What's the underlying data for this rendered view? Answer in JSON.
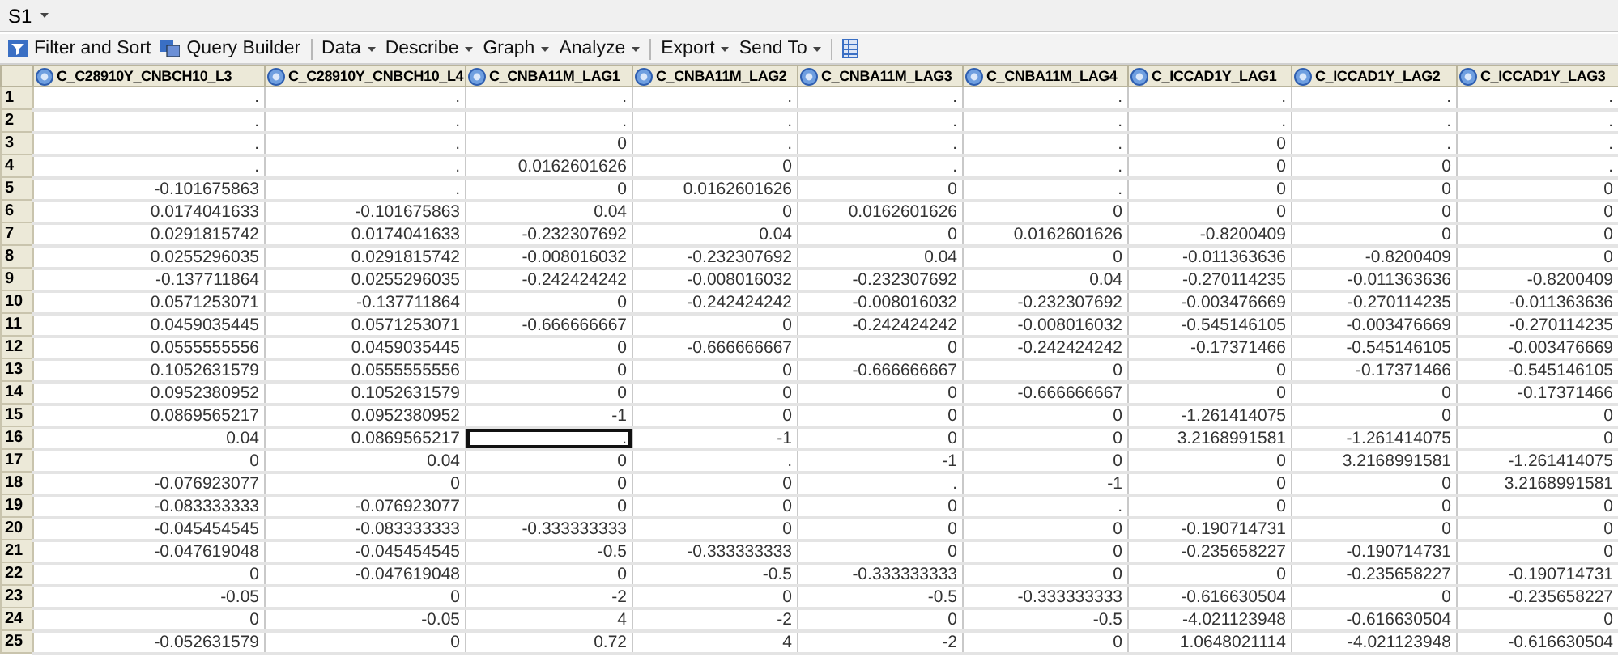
{
  "tab": {
    "label": "S1"
  },
  "toolbar": [
    {
      "kind": "tool",
      "label": "Filter and Sort"
    },
    {
      "kind": "tool",
      "label": "Query Builder"
    },
    {
      "kind": "separator"
    },
    {
      "kind": "menu",
      "label": "Data"
    },
    {
      "kind": "menu",
      "label": "Describe"
    },
    {
      "kind": "menu",
      "label": "Graph"
    },
    {
      "kind": "menu",
      "label": "Analyze"
    },
    {
      "kind": "separator"
    },
    {
      "kind": "menu",
      "label": "Export"
    },
    {
      "kind": "menu",
      "label": "Send To"
    },
    {
      "kind": "separator"
    },
    {
      "kind": "icon"
    }
  ],
  "table": {
    "columns": [
      "C_C28910Y_CNBCH10_L3",
      "C_C28910Y_CNBCH10_L4",
      "C_CNBA11M_LAG1",
      "C_CNBA11M_LAG2",
      "C_CNBA11M_LAG3",
      "C_CNBA11M_LAG4",
      "C_ICCAD1Y_LAG1",
      "C_ICCAD1Y_LAG2",
      "C_ICCAD1Y_LAG3"
    ],
    "rows": [
      {
        "label": "1",
        "cells": [
          {
            "text": ".",
            "active": false
          },
          {
            "text": ".",
            "active": false
          },
          {
            "text": ".",
            "active": false
          },
          {
            "text": ".",
            "active": false
          },
          {
            "text": ".",
            "active": false
          },
          {
            "text": ".",
            "active": false
          },
          {
            "text": ".",
            "active": false
          },
          {
            "text": ".",
            "active": false
          },
          {
            "text": ".",
            "active": false
          }
        ]
      },
      {
        "label": "2",
        "cells": [
          {
            "text": ".",
            "active": false
          },
          {
            "text": ".",
            "active": false
          },
          {
            "text": ".",
            "active": false
          },
          {
            "text": ".",
            "active": false
          },
          {
            "text": ".",
            "active": false
          },
          {
            "text": ".",
            "active": false
          },
          {
            "text": ".",
            "active": false
          },
          {
            "text": ".",
            "active": false
          },
          {
            "text": ".",
            "active": false
          }
        ]
      },
      {
        "label": "3",
        "cells": [
          {
            "text": ".",
            "active": false
          },
          {
            "text": ".",
            "active": false
          },
          {
            "text": "0",
            "active": false
          },
          {
            "text": ".",
            "active": false
          },
          {
            "text": ".",
            "active": false
          },
          {
            "text": ".",
            "active": false
          },
          {
            "text": "0",
            "active": false
          },
          {
            "text": ".",
            "active": false
          },
          {
            "text": ".",
            "active": false
          }
        ]
      },
      {
        "label": "4",
        "cells": [
          {
            "text": ".",
            "active": false
          },
          {
            "text": ".",
            "active": false
          },
          {
            "text": "0.0162601626",
            "active": false
          },
          {
            "text": "0",
            "active": false
          },
          {
            "text": ".",
            "active": false
          },
          {
            "text": ".",
            "active": false
          },
          {
            "text": "0",
            "active": false
          },
          {
            "text": "0",
            "active": false
          },
          {
            "text": ".",
            "active": false
          }
        ]
      },
      {
        "label": "5",
        "cells": [
          {
            "text": "-0.101675863",
            "active": false
          },
          {
            "text": ".",
            "active": false
          },
          {
            "text": "0",
            "active": false
          },
          {
            "text": "0.0162601626",
            "active": false
          },
          {
            "text": "0",
            "active": false
          },
          {
            "text": ".",
            "active": false
          },
          {
            "text": "0",
            "active": false
          },
          {
            "text": "0",
            "active": false
          },
          {
            "text": "0",
            "active": false
          }
        ]
      },
      {
        "label": "6",
        "cells": [
          {
            "text": "0.0174041633",
            "active": false
          },
          {
            "text": "-0.101675863",
            "active": false
          },
          {
            "text": "0.04",
            "active": false
          },
          {
            "text": "0",
            "active": false
          },
          {
            "text": "0.0162601626",
            "active": false
          },
          {
            "text": "0",
            "active": false
          },
          {
            "text": "0",
            "active": false
          },
          {
            "text": "0",
            "active": false
          },
          {
            "text": "0",
            "active": false
          }
        ]
      },
      {
        "label": "7",
        "cells": [
          {
            "text": "0.0291815742",
            "active": false
          },
          {
            "text": "0.0174041633",
            "active": false
          },
          {
            "text": "-0.232307692",
            "active": false
          },
          {
            "text": "0.04",
            "active": false
          },
          {
            "text": "0",
            "active": false
          },
          {
            "text": "0.0162601626",
            "active": false
          },
          {
            "text": "-0.8200409",
            "active": false
          },
          {
            "text": "0",
            "active": false
          },
          {
            "text": "0",
            "active": false
          }
        ]
      },
      {
        "label": "8",
        "cells": [
          {
            "text": "0.0255296035",
            "active": false
          },
          {
            "text": "0.0291815742",
            "active": false
          },
          {
            "text": "-0.008016032",
            "active": false
          },
          {
            "text": "-0.232307692",
            "active": false
          },
          {
            "text": "0.04",
            "active": false
          },
          {
            "text": "0",
            "active": false
          },
          {
            "text": "-0.011363636",
            "active": false
          },
          {
            "text": "-0.8200409",
            "active": false
          },
          {
            "text": "0",
            "active": false
          }
        ]
      },
      {
        "label": "9",
        "cells": [
          {
            "text": "-0.137711864",
            "active": false
          },
          {
            "text": "0.0255296035",
            "active": false
          },
          {
            "text": "-0.242424242",
            "active": false
          },
          {
            "text": "-0.008016032",
            "active": false
          },
          {
            "text": "-0.232307692",
            "active": false
          },
          {
            "text": "0.04",
            "active": false
          },
          {
            "text": "-0.270114235",
            "active": false
          },
          {
            "text": "-0.011363636",
            "active": false
          },
          {
            "text": "-0.8200409",
            "active": false
          }
        ]
      },
      {
        "label": "10",
        "cells": [
          {
            "text": "0.0571253071",
            "active": false
          },
          {
            "text": "-0.137711864",
            "active": false
          },
          {
            "text": "0",
            "active": false
          },
          {
            "text": "-0.242424242",
            "active": false
          },
          {
            "text": "-0.008016032",
            "active": false
          },
          {
            "text": "-0.232307692",
            "active": false
          },
          {
            "text": "-0.003476669",
            "active": false
          },
          {
            "text": "-0.270114235",
            "active": false
          },
          {
            "text": "-0.011363636",
            "active": false
          }
        ]
      },
      {
        "label": "11",
        "cells": [
          {
            "text": "0.0459035445",
            "active": false
          },
          {
            "text": "0.0571253071",
            "active": false
          },
          {
            "text": "-0.666666667",
            "active": false
          },
          {
            "text": "0",
            "active": false
          },
          {
            "text": "-0.242424242",
            "active": false
          },
          {
            "text": "-0.008016032",
            "active": false
          },
          {
            "text": "-0.545146105",
            "active": false
          },
          {
            "text": "-0.003476669",
            "active": false
          },
          {
            "text": "-0.270114235",
            "active": false
          }
        ]
      },
      {
        "label": "12",
        "cells": [
          {
            "text": "0.0555555556",
            "active": false
          },
          {
            "text": "0.0459035445",
            "active": false
          },
          {
            "text": "0",
            "active": false
          },
          {
            "text": "-0.666666667",
            "active": false
          },
          {
            "text": "0",
            "active": false
          },
          {
            "text": "-0.242424242",
            "active": false
          },
          {
            "text": "-0.17371466",
            "active": false
          },
          {
            "text": "-0.545146105",
            "active": false
          },
          {
            "text": "-0.003476669",
            "active": false
          }
        ]
      },
      {
        "label": "13",
        "cells": [
          {
            "text": "0.1052631579",
            "active": false
          },
          {
            "text": "0.0555555556",
            "active": false
          },
          {
            "text": "0",
            "active": false
          },
          {
            "text": "0",
            "active": false
          },
          {
            "text": "-0.666666667",
            "active": false
          },
          {
            "text": "0",
            "active": false
          },
          {
            "text": "0",
            "active": false
          },
          {
            "text": "-0.17371466",
            "active": false
          },
          {
            "text": "-0.545146105",
            "active": false
          }
        ]
      },
      {
        "label": "14",
        "cells": [
          {
            "text": "0.0952380952",
            "active": false
          },
          {
            "text": "0.1052631579",
            "active": false
          },
          {
            "text": "0",
            "active": false
          },
          {
            "text": "0",
            "active": false
          },
          {
            "text": "0",
            "active": false
          },
          {
            "text": "-0.666666667",
            "active": false
          },
          {
            "text": "0",
            "active": false
          },
          {
            "text": "0",
            "active": false
          },
          {
            "text": "-0.17371466",
            "active": false
          }
        ]
      },
      {
        "label": "15",
        "cells": [
          {
            "text": "0.0869565217",
            "active": false
          },
          {
            "text": "0.0952380952",
            "active": false
          },
          {
            "text": "-1",
            "active": false
          },
          {
            "text": "0",
            "active": false
          },
          {
            "text": "0",
            "active": false
          },
          {
            "text": "0",
            "active": false
          },
          {
            "text": "-1.261414075",
            "active": false
          },
          {
            "text": "0",
            "active": false
          },
          {
            "text": "0",
            "active": false
          }
        ]
      },
      {
        "label": "16",
        "cells": [
          {
            "text": "0.04",
            "active": false
          },
          {
            "text": "0.0869565217",
            "active": false
          },
          {
            "text": ".",
            "active": true
          },
          {
            "text": "-1",
            "active": false
          },
          {
            "text": "0",
            "active": false
          },
          {
            "text": "0",
            "active": false
          },
          {
            "text": "3.2168991581",
            "active": false
          },
          {
            "text": "-1.261414075",
            "active": false
          },
          {
            "text": "0",
            "active": false
          }
        ]
      },
      {
        "label": "17",
        "cells": [
          {
            "text": "0",
            "active": false
          },
          {
            "text": "0.04",
            "active": false
          },
          {
            "text": "0",
            "active": false
          },
          {
            "text": ".",
            "active": false
          },
          {
            "text": "-1",
            "active": false
          },
          {
            "text": "0",
            "active": false
          },
          {
            "text": "0",
            "active": false
          },
          {
            "text": "3.2168991581",
            "active": false
          },
          {
            "text": "-1.261414075",
            "active": false
          }
        ]
      },
      {
        "label": "18",
        "cells": [
          {
            "text": "-0.076923077",
            "active": false
          },
          {
            "text": "0",
            "active": false
          },
          {
            "text": "0",
            "active": false
          },
          {
            "text": "0",
            "active": false
          },
          {
            "text": ".",
            "active": false
          },
          {
            "text": "-1",
            "active": false
          },
          {
            "text": "0",
            "active": false
          },
          {
            "text": "0",
            "active": false
          },
          {
            "text": "3.2168991581",
            "active": false
          }
        ]
      },
      {
        "label": "19",
        "cells": [
          {
            "text": "-0.083333333",
            "active": false
          },
          {
            "text": "-0.076923077",
            "active": false
          },
          {
            "text": "0",
            "active": false
          },
          {
            "text": "0",
            "active": false
          },
          {
            "text": "0",
            "active": false
          },
          {
            "text": ".",
            "active": false
          },
          {
            "text": "0",
            "active": false
          },
          {
            "text": "0",
            "active": false
          },
          {
            "text": "0",
            "active": false
          }
        ]
      },
      {
        "label": "20",
        "cells": [
          {
            "text": "-0.045454545",
            "active": false
          },
          {
            "text": "-0.083333333",
            "active": false
          },
          {
            "text": "-0.333333333",
            "active": false
          },
          {
            "text": "0",
            "active": false
          },
          {
            "text": "0",
            "active": false
          },
          {
            "text": "0",
            "active": false
          },
          {
            "text": "-0.190714731",
            "active": false
          },
          {
            "text": "0",
            "active": false
          },
          {
            "text": "0",
            "active": false
          }
        ]
      },
      {
        "label": "21",
        "cells": [
          {
            "text": "-0.047619048",
            "active": false
          },
          {
            "text": "-0.045454545",
            "active": false
          },
          {
            "text": "-0.5",
            "active": false
          },
          {
            "text": "-0.333333333",
            "active": false
          },
          {
            "text": "0",
            "active": false
          },
          {
            "text": "0",
            "active": false
          },
          {
            "text": "-0.235658227",
            "active": false
          },
          {
            "text": "-0.190714731",
            "active": false
          },
          {
            "text": "0",
            "active": false
          }
        ]
      },
      {
        "label": "22",
        "cells": [
          {
            "text": "0",
            "active": false
          },
          {
            "text": "-0.047619048",
            "active": false
          },
          {
            "text": "0",
            "active": false
          },
          {
            "text": "-0.5",
            "active": false
          },
          {
            "text": "-0.333333333",
            "active": false
          },
          {
            "text": "0",
            "active": false
          },
          {
            "text": "0",
            "active": false
          },
          {
            "text": "-0.235658227",
            "active": false
          },
          {
            "text": "-0.190714731",
            "active": false
          }
        ]
      },
      {
        "label": "23",
        "cells": [
          {
            "text": "-0.05",
            "active": false
          },
          {
            "text": "0",
            "active": false
          },
          {
            "text": "-2",
            "active": false
          },
          {
            "text": "0",
            "active": false
          },
          {
            "text": "-0.5",
            "active": false
          },
          {
            "text": "-0.333333333",
            "active": false
          },
          {
            "text": "-0.616630504",
            "active": false
          },
          {
            "text": "0",
            "active": false
          },
          {
            "text": "-0.235658227",
            "active": false
          }
        ]
      },
      {
        "label": "24",
        "cells": [
          {
            "text": "0",
            "active": false
          },
          {
            "text": "-0.05",
            "active": false
          },
          {
            "text": "4",
            "active": false
          },
          {
            "text": "-2",
            "active": false
          },
          {
            "text": "0",
            "active": false
          },
          {
            "text": "-0.5",
            "active": false
          },
          {
            "text": "-4.021123948",
            "active": false
          },
          {
            "text": "-0.616630504",
            "active": false
          },
          {
            "text": "0",
            "active": false
          }
        ]
      },
      {
        "label": "25",
        "cells": [
          {
            "text": "-0.052631579",
            "active": false
          },
          {
            "text": "0",
            "active": false
          },
          {
            "text": "0.72",
            "active": false
          },
          {
            "text": "4",
            "active": false
          },
          {
            "text": "-2",
            "active": false
          },
          {
            "text": "0",
            "active": false
          },
          {
            "text": "1.0648021114",
            "active": false
          },
          {
            "text": "-4.021123948",
            "active": false
          },
          {
            "text": "-0.616630504",
            "active": false
          }
        ]
      }
    ]
  }
}
